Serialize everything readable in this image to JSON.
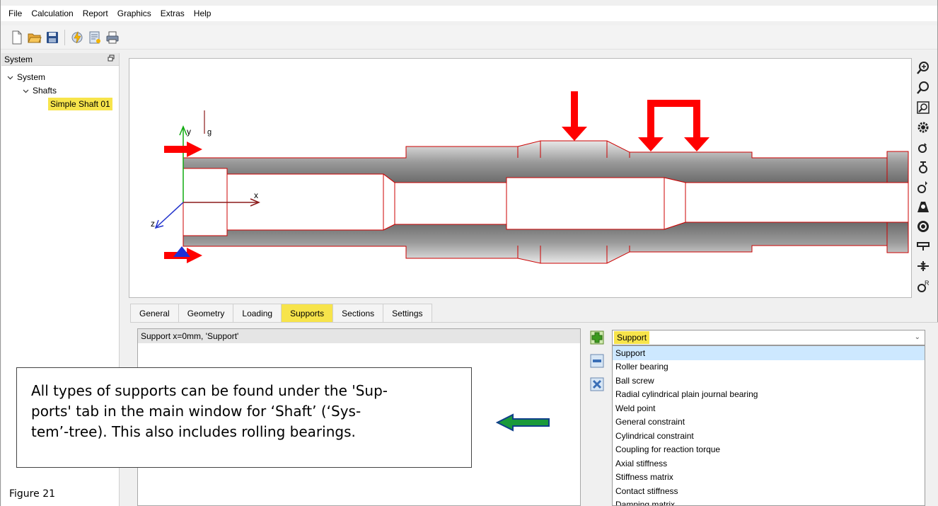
{
  "menu": [
    "File",
    "Calculation",
    "Report",
    "Graphics",
    "Extras",
    "Help"
  ],
  "toolbar": {
    "icons": [
      "new-file-icon",
      "open-folder-icon",
      "save-icon",
      "calculate-icon",
      "report-icon",
      "print-icon"
    ]
  },
  "system_panel": {
    "title": "System",
    "float_glyph": "ꟷ",
    "tree": {
      "root": "System",
      "group": "Shafts",
      "selected": "Simple Shaft 01"
    }
  },
  "graphics": {
    "axis_x": "x",
    "axis_y": "y",
    "axis_z": "z",
    "gravity": "g"
  },
  "right_toolbar": {
    "icons": [
      "zoom-in-icon",
      "zoom-out-icon",
      "zoom-window-icon",
      "gear-icon",
      "rotate-icon",
      "bearing-icon",
      "bearing-add-icon",
      "weight-icon",
      "disk-icon",
      "support-icon",
      "coupling-icon",
      "reaction-icon"
    ]
  },
  "tabs": [
    "General",
    "Geometry",
    "Loading",
    "Supports",
    "Sections",
    "Settings"
  ],
  "active_tab": "Supports",
  "supports": {
    "rows": [
      "Support  x=0mm, 'Support'"
    ]
  },
  "type_select": {
    "value": "Support",
    "options": [
      "Support",
      "Roller bearing",
      "Ball screw",
      "Radial cylindrical plain journal bearing",
      "Weld point",
      "General constraint",
      "Cylindrical constraint",
      "Coupling for reaction torque",
      "Axial stiffness",
      "Stiffness matrix",
      "Contact stiffness",
      "Damping matrix"
    ]
  },
  "callout": {
    "line1": "All types of supports can be found under the 'Sup-",
    "line2": "ports' tab in the main window for ‘Shaft’ (‘Sys-",
    "line3": "tem’-tree). This also includes rolling bearings."
  },
  "figure_label": "Figure 21",
  "colors": {
    "highlight": "#f7e44b",
    "load_arrow": "#ff0000",
    "shaft_outline": "#cc0000",
    "callout_arrow": "#1a9a3a"
  }
}
